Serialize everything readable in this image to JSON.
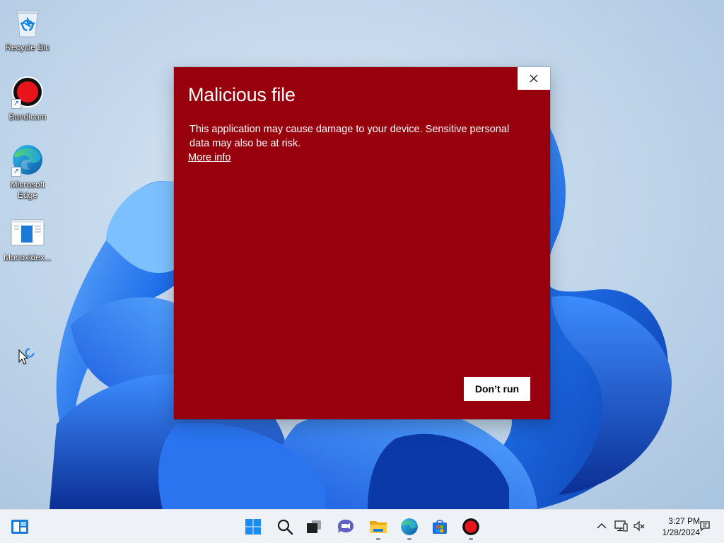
{
  "desktop": {
    "icons": [
      {
        "label": "Recycle Bin",
        "icon": "recycle-bin-icon"
      },
      {
        "label": "Bandicam",
        "icon": "bandicam-icon"
      },
      {
        "label": "Microsoft Edge",
        "icon": "edge-icon"
      },
      {
        "label": "Monoxidex...",
        "icon": "document-icon"
      }
    ]
  },
  "dialog": {
    "title": "Malicious file",
    "message": "This application may cause damage to your device. Sensitive personal data may also be at risk.",
    "link": "More info",
    "button": "Don’t run",
    "close_icon": "close-icon",
    "background": "#99000d"
  },
  "taskbar": {
    "widgets_icon": "widgets-icon",
    "pinned": [
      {
        "name": "start",
        "icon": "windows-start-icon"
      },
      {
        "name": "search",
        "icon": "search-icon"
      },
      {
        "name": "task-view",
        "icon": "task-view-icon"
      },
      {
        "name": "teams-chat",
        "icon": "chat-icon"
      },
      {
        "name": "file-explorer",
        "icon": "folder-icon"
      },
      {
        "name": "edge",
        "icon": "edge-icon"
      },
      {
        "name": "store",
        "icon": "store-icon"
      },
      {
        "name": "bandicam",
        "icon": "bandicam-icon"
      }
    ],
    "tray": {
      "chevron_icon": "chevron-up-icon",
      "network_icon": "network-icon",
      "volume_icon": "volume-muted-icon",
      "time": "3:27 PM",
      "date": "1/28/2024",
      "notification_icon": "notification-icon"
    }
  }
}
